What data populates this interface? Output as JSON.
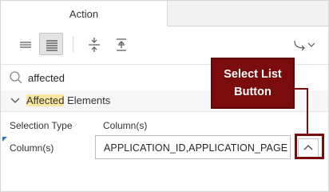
{
  "tabs": [
    {
      "label": "Action"
    }
  ],
  "search": {
    "value": "affected"
  },
  "group": {
    "highlight": "Affected",
    "rest": " Elements"
  },
  "properties": {
    "label_col": "Selection Type",
    "value_col": "Column(s)",
    "row_label": "Column(s)",
    "row_value": "APPLICATION_ID,APPLICATION_PAGE"
  },
  "callout": {
    "line1": "Select List",
    "line2": "Button"
  },
  "colors": {
    "callout": "#7a0c0c",
    "highlight": "#fbe7a1",
    "accent": "#2d7cc1"
  }
}
